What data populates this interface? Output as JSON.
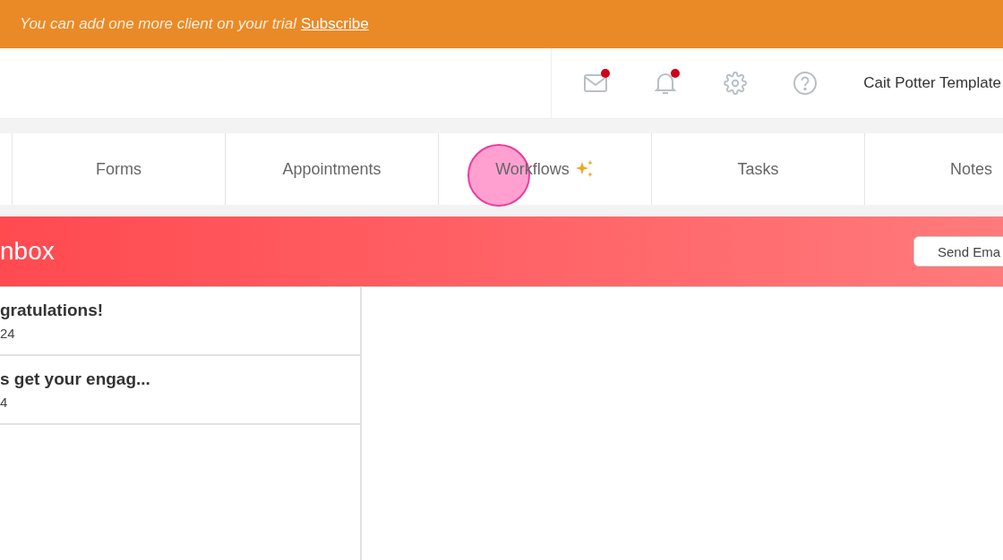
{
  "banner": {
    "message": "You can add one more client on your trial",
    "link": "Subscribe"
  },
  "header": {
    "icons": [
      {
        "kind": "mail",
        "unread": true
      },
      {
        "kind": "bell",
        "unread": true
      },
      {
        "kind": "gear",
        "unread": false
      },
      {
        "kind": "help",
        "unread": false
      }
    ],
    "account": "Cait Potter Template"
  },
  "tabs": [
    {
      "label": "Forms",
      "sparkle": false,
      "clicked": false
    },
    {
      "label": "Appointments",
      "sparkle": false,
      "clicked": false
    },
    {
      "label": "Workflows",
      "sparkle": true,
      "clicked": true
    },
    {
      "label": "Tasks",
      "sparkle": false,
      "clicked": false
    },
    {
      "label": "Notes",
      "sparkle": false,
      "clicked": false
    }
  ],
  "inbox": {
    "title": "nbox",
    "button": "Send Ema",
    "messages": [
      {
        "subject": "gratulations!",
        "date": "24"
      },
      {
        "subject": "s get your engag...",
        "date": "4"
      }
    ]
  }
}
